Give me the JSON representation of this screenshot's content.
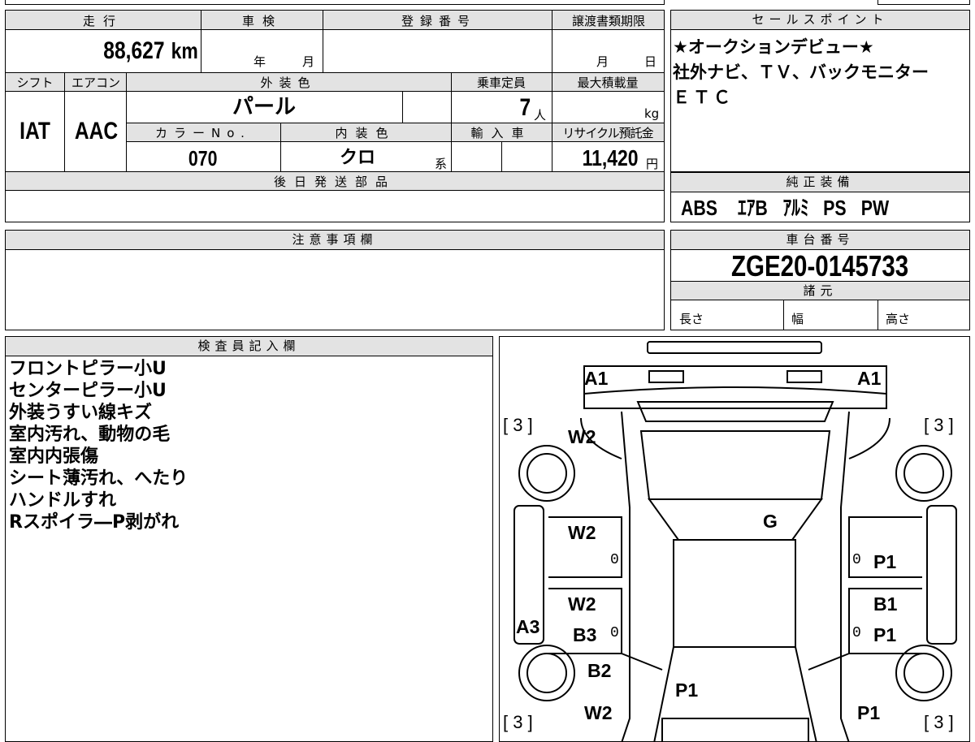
{
  "spec": {
    "labels": {
      "mileage": "走行",
      "inspection": "車検",
      "registration": "登録番号",
      "transfer_deadline": "譲渡書類期限",
      "shift": "シフト",
      "aircon": "エアコン",
      "ext_color": "外装色",
      "capacity": "乗車定員",
      "max_load": "最大積載量",
      "color_no": "カラーNo.",
      "int_color": "内装色",
      "import": "輸入車",
      "recycle": "リサイクル預託金",
      "later_parts": "後日発送部品"
    },
    "mileage_value": "88,627",
    "mileage_unit": "km",
    "year_unit": "年",
    "month_unit": "月",
    "day_unit": "日",
    "shift_value": "IAT",
    "aircon_value": "AAC",
    "ext_color_value": "パール",
    "capacity_value": "7",
    "capacity_unit": "人",
    "load_unit": "kg",
    "color_no_value": "070",
    "int_color_value": "クロ",
    "int_color_suffix": "系",
    "recycle_value": "11,420",
    "recycle_unit": "円"
  },
  "sales": {
    "title": "セールスポイント",
    "lines": [
      "★オークションデビュー★",
      "社外ナビ、ＴＶ、バックモニター",
      "ＥＴＣ"
    ]
  },
  "equipment": {
    "title": "純正装備",
    "items": [
      "ABS",
      "ｴｱB",
      "ｱﾙﾐ",
      "PS",
      "PW"
    ]
  },
  "caution": {
    "title": "注意事項欄"
  },
  "chassis": {
    "title": "車台番号",
    "value": "ZGE20-0145733",
    "spec_title": "諸元",
    "length": "長さ",
    "width": "幅",
    "height": "高さ"
  },
  "inspector": {
    "title": "検査員記入欄",
    "notes": [
      "フロントピラー小U",
      "センターピラー小U",
      "外装うすい線キズ",
      "室内汚れ、動物の毛",
      "室内内張傷",
      "シート薄汚れ、へたり",
      "ハンドルすれ",
      "Rスポイラ―P剥がれ"
    ]
  },
  "diagram": {
    "marks": {
      "front_left": "A1",
      "front_right": "A1",
      "front_fender_left": "W2",
      "hood": "G",
      "front_door_left": "W2",
      "front_door_right": "P1",
      "rear_door_left": "W2",
      "rear_door_left_2": "B3",
      "rear_door_right_1": "B1",
      "rear_door_right_2": "P1",
      "left_sill": "A3",
      "rear_fender_left": "B2",
      "rear_quarter_left": "W2",
      "rear_hatch": "P1",
      "rear_quarter_right": "P1"
    },
    "tyres": [
      "[ 3 ]",
      "[ 3 ]",
      "[ 3 ]",
      "[ 3 ]"
    ],
    "zeros": [
      "0",
      "0",
      "0",
      "0"
    ]
  }
}
